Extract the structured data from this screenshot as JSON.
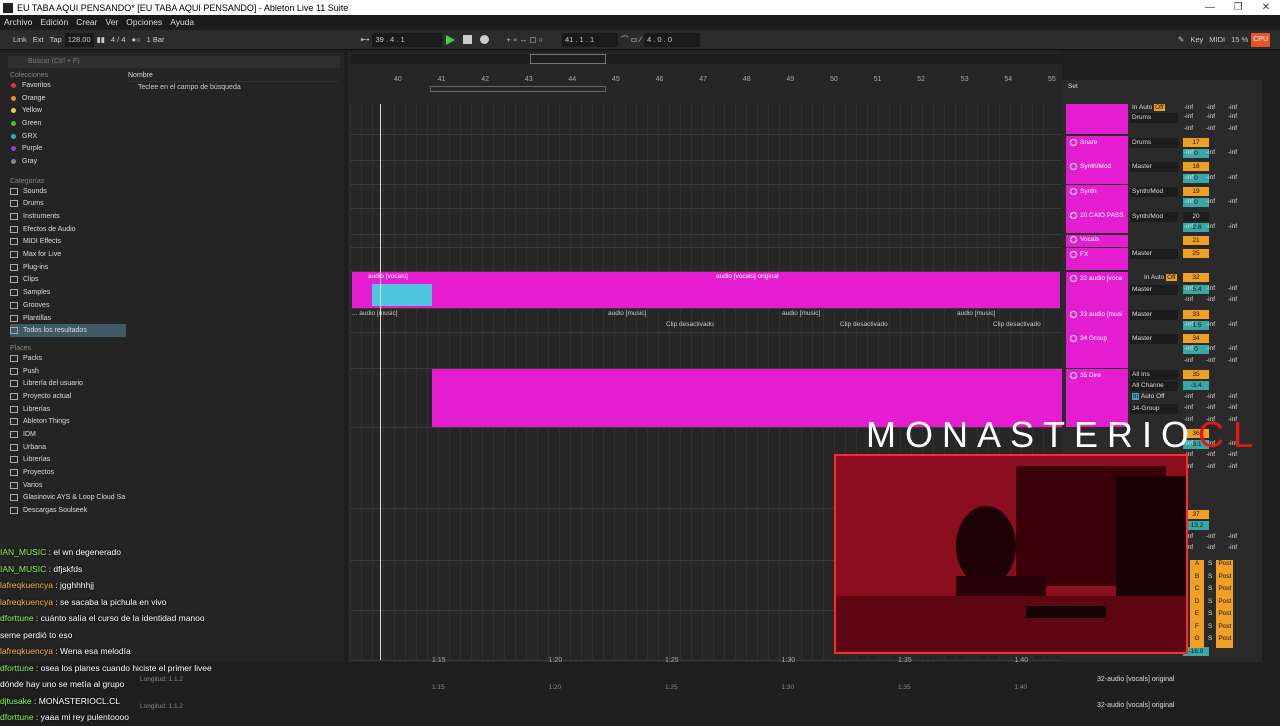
{
  "window": {
    "title": "EU TABA AQUI PENSANDO*  [EU TABA AQUI PENSANDO] - Ableton Live 11 Suite"
  },
  "menu": [
    "Archivo",
    "Edición",
    "Crear",
    "Ver",
    "Opciones",
    "Ayuda"
  ],
  "control": {
    "link": "Link",
    "ext": "Ext",
    "tap": "Tap",
    "tempo": "128.00",
    "sig": "4 / 4",
    "quant": "1 Bar",
    "pos1": "39 .   4 .   1",
    "pos2": "41 .   1 .   1",
    "pos3": "4 .   0 .   0",
    "key": "Key",
    "midi": "MIDI",
    "cpu_pct": "15 %",
    "cpu": "CPU"
  },
  "browser": {
    "search_placeholder": "Buscar (Ctrl + F)",
    "col_header": "Nombre",
    "hint": "Teclee en el campo de búsqueda",
    "colecciones_title": "Colecciones",
    "colecciones": [
      {
        "label": "Favoritos",
        "color": "#e83030"
      },
      {
        "label": "Orange",
        "color": "#f08a1c"
      },
      {
        "label": "Yellow",
        "color": "#f0d030"
      },
      {
        "label": "Green",
        "color": "#40c040"
      },
      {
        "label": "GRX",
        "color": "#30b0b0"
      },
      {
        "label": "Purple",
        "color": "#9040d0"
      },
      {
        "label": "Gray",
        "color": "#888888"
      }
    ],
    "categorias_title": "Categorías",
    "categorias": [
      "Sounds",
      "Drums",
      "Instruments",
      "Efectos de Audio",
      "MIDI Effects",
      "Max for Live",
      "Plug-ins",
      "Clips",
      "Samples",
      "Grooves",
      "Plantillas",
      "Todos los resultados"
    ],
    "places_title": "Places",
    "places": [
      "Packs",
      "Push",
      "Librería del usuario",
      "Proyecto actual",
      "Librerías",
      "Ableton Things",
      "IDM",
      "Urbana",
      "Librerías",
      "Proyectos",
      "Varios",
      "Glasinovic AYS & Loop Cloud Sa",
      "Descargas Soulseek"
    ]
  },
  "ruler": [
    "40",
    "41",
    "42",
    "43",
    "44",
    "45",
    "46",
    "47",
    "48",
    "49",
    "50",
    "51",
    "52",
    "53",
    "54",
    "55"
  ],
  "timeline": [
    "1:15",
    "1:20",
    "1:25",
    "1:30",
    "1:35",
    "1:40"
  ],
  "clips": {
    "audio_vocals": "audio [vocals]",
    "audio_vocals_original": "audio [vocals] original",
    "audio_music": "audio [music]",
    "music_start": "... audio [music]",
    "disabled": "Clip desactivado"
  },
  "tracks": [
    "Snare",
    "Synth/Mod",
    "Synth",
    "20 CAIO PASS",
    "Vocals",
    "FX",
    "32 audio [voca",
    "33 audio [musi",
    "34 Group",
    "35 Dire"
  ],
  "mixer": {
    "set": "Set",
    "drums": "Drums",
    "master": "Master",
    "synthmod": "Synth/Mod",
    "allins": "All Ins",
    "allchann": "All Channe",
    "group34": "34-Group",
    "in": "In",
    "auto": "Auto",
    "off": "Off",
    "inf": "-inf",
    "c": "C",
    "s": "S",
    "nums": [
      "17",
      "18",
      "19",
      "20",
      "21",
      "25",
      "32",
      "33",
      "34",
      "35",
      "36",
      "37"
    ],
    "vals": [
      "0",
      "0",
      "0",
      "-2.8",
      "-5.4",
      "-1.5",
      "0",
      "-3.4",
      "-3.1",
      "-13.2",
      "-16.0"
    ],
    "sends": [
      "A",
      "B",
      "C",
      "D",
      "E",
      "F",
      "G"
    ],
    "post": "Post"
  },
  "overlay": {
    "logo_main": "MONASTERIO",
    "logo_accent": "CL"
  },
  "chat": [
    {
      "user": "IAN_MUSIC",
      "msg": " : el wn degenerado",
      "cls": "u1"
    },
    {
      "user": "IAN_MUSIC",
      "msg": " : dfjskfds",
      "cls": "u1"
    },
    {
      "user": "lafreqkuencya",
      "msg": " : jgghhhhjj",
      "cls": "u2"
    },
    {
      "user": "lafreqkuencya",
      "msg": " : se sacaba la pichula en vivo",
      "cls": "u2"
    },
    {
      "user": "dforttune",
      "msg": " : cuánto salía el curso de la identidad manoo",
      "cls": "u1"
    },
    {
      "user": "",
      "msg": "seme perdió to eso",
      "cls": "u1"
    },
    {
      "user": "lafreqkuencya",
      "msg": " : Wena esa melodía",
      "cls": "u2"
    },
    {
      "user": "dforttune",
      "msg": " : osea los planes cuando hiciste el primer livee",
      "cls": "u1"
    },
    {
      "user": "",
      "msg": "dónde hay uno se metía al grupo",
      "cls": "u1"
    },
    {
      "user": "djtusake",
      "msg": " : MONASTERIOCL.CL",
      "cls": "u1"
    },
    {
      "user": "dforttune",
      "msg": " : yaaa mi rey pulentoooo",
      "cls": "u1"
    }
  ],
  "bottom": {
    "clipname": "32-audio [vocals] original",
    "longitud": "Longitud: 1.1.2"
  }
}
